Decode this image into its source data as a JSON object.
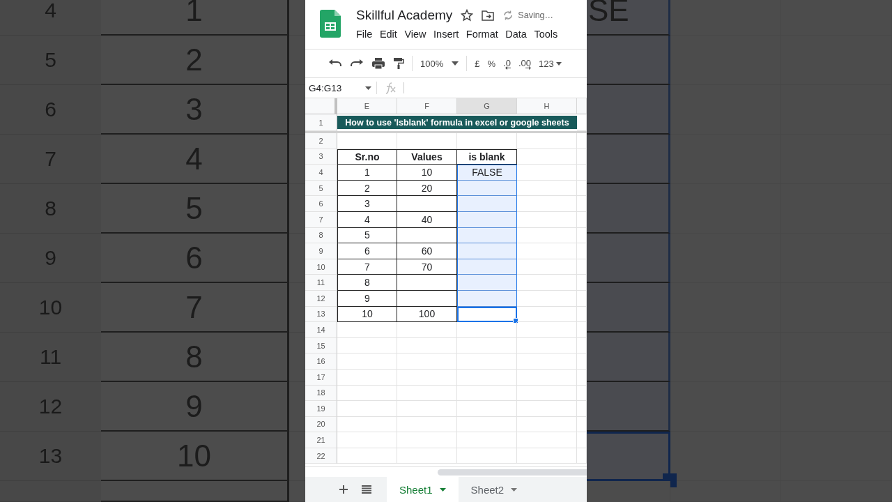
{
  "backdrop": {
    "left_rows": [
      {
        "row": "4",
        "value": "1"
      },
      {
        "row": "5",
        "value": "2"
      },
      {
        "row": "6",
        "value": "3"
      },
      {
        "row": "7",
        "value": "4"
      },
      {
        "row": "8",
        "value": "5"
      },
      {
        "row": "9",
        "value": "6"
      },
      {
        "row": "10",
        "value": "7"
      },
      {
        "row": "11",
        "value": "8"
      },
      {
        "row": "12",
        "value": "9"
      },
      {
        "row": "13",
        "value": "10"
      }
    ],
    "right_text": "SE"
  },
  "app": {
    "title": "Skillful Academy",
    "status": "Saving…",
    "menu": [
      "File",
      "Edit",
      "View",
      "Insert",
      "Format",
      "Data",
      "Tools"
    ],
    "toolbar": {
      "zoom": "100%",
      "currency": "£",
      "percent": "%",
      "decrease_decimals": ".0",
      "increase_decimals": ".00",
      "more_formats": "123"
    },
    "name_box": "G4:G13",
    "columns": [
      {
        "label": "E",
        "selected": false
      },
      {
        "label": "F",
        "selected": false
      },
      {
        "label": "G",
        "selected": true
      },
      {
        "label": "H",
        "selected": false
      }
    ],
    "banner": "How to use 'Isblank' formula in excel or google sheets",
    "table": {
      "headers": [
        "Sr.no",
        "Values",
        "is blank"
      ],
      "rows": [
        {
          "sr": "1",
          "value": "10",
          "result": "FALSE",
          "selected": true,
          "active": false
        },
        {
          "sr": "2",
          "value": "20",
          "selected": true,
          "active": false
        },
        {
          "sr": "3",
          "selected": true,
          "active": false
        },
        {
          "sr": "4",
          "value": "40",
          "selected": true,
          "active": false
        },
        {
          "sr": "5",
          "selected": true,
          "active": false
        },
        {
          "sr": "6",
          "value": "60",
          "selected": true,
          "active": false
        },
        {
          "sr": "7",
          "value": "70",
          "selected": true,
          "active": false
        },
        {
          "sr": "8",
          "selected": true,
          "active": false
        },
        {
          "sr": "9",
          "selected": true,
          "active": false
        },
        {
          "sr": "10",
          "value": "100",
          "selected": true,
          "active": true
        }
      ]
    },
    "row_numbers": [
      "1",
      "2",
      "3",
      "4",
      "5",
      "6",
      "7",
      "8",
      "9",
      "10",
      "11",
      "12",
      "13",
      "14",
      "15",
      "16",
      "17",
      "18",
      "19",
      "20",
      "21",
      "22"
    ],
    "sheets": [
      {
        "label": "Sheet1",
        "selected": true
      },
      {
        "label": "Sheet2",
        "selected": false
      }
    ]
  }
}
